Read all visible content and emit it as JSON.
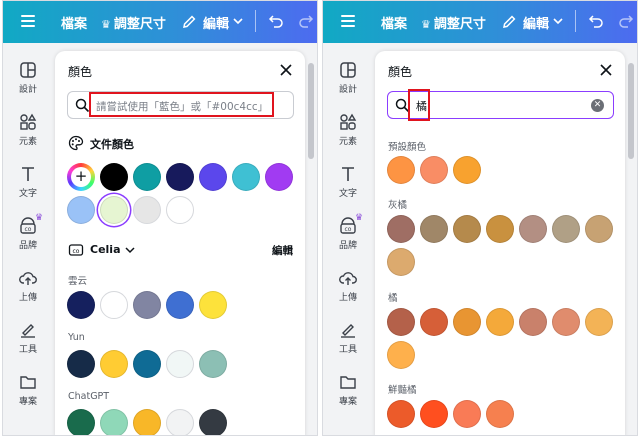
{
  "topbar": {
    "file": "檔案",
    "resize": "調整尺寸",
    "edit": "編輯"
  },
  "sidebar": {
    "items": [
      {
        "icon": "layout-icon",
        "label": "設計"
      },
      {
        "icon": "elements-icon",
        "label": "元素"
      },
      {
        "icon": "text-icon",
        "label": "文字"
      },
      {
        "icon": "brand-icon",
        "label": "品牌"
      },
      {
        "icon": "upload-icon",
        "label": "上傳"
      },
      {
        "icon": "draw-icon",
        "label": "工具"
      },
      {
        "icon": "projects-icon",
        "label": "專案"
      }
    ]
  },
  "left_drawer": {
    "title": "顏色",
    "search_placeholder": "請嘗試使用「藍色」或「#00c4cc」",
    "doc_colors_label": "文件顏色",
    "doc_colors": [
      "#000000",
      "#0f9ea3",
      "#171a5c",
      "#5b47ec",
      "#3fc0d3",
      "#a13bf2",
      "#9ac2f7",
      "#e6f5d2",
      "#e6e6e6",
      "#ffffff"
    ],
    "brand_kit_name": "Celia",
    "edit_label": "編輯",
    "palettes": [
      {
        "name": "雲云",
        "colors": [
          "#15205e",
          "#ffffff",
          "#8185a2",
          "#3f6fd2",
          "#fde23b"
        ]
      },
      {
        "name": "Yun",
        "colors": [
          "#162b48",
          "#ffcc33",
          "#0f6b95",
          "#f1f7f6",
          "#8cbfb4"
        ]
      },
      {
        "name": "ChatGPT",
        "colors": [
          "#196b4c",
          "#8fd8b8",
          "#f8b728",
          "#f2f3f4",
          "#343a42"
        ]
      }
    ]
  },
  "right_drawer": {
    "title": "顏色",
    "search_value": "橘",
    "groups": [
      {
        "name": "預設顏色",
        "colors": [
          "#fd9443",
          "#f98d65",
          "#f8a22f"
        ]
      },
      {
        "name": "灰橘",
        "colors": [
          "#9f6e64",
          "#a08768",
          "#b58a4c",
          "#c9913f",
          "#b38f83",
          "#b0a086",
          "#c7a273",
          "#dcaa6e"
        ]
      },
      {
        "name": "橘",
        "colors": [
          "#b4614a",
          "#d65f38",
          "#e89532",
          "#f4a93a",
          "#c9816b",
          "#e08c6d",
          "#f3b356",
          "#feb04c"
        ]
      },
      {
        "name": "鮮豔橘",
        "colors": [
          "#ec5b2a",
          "#ff4f1f",
          "#f97b56",
          "#f6804f"
        ]
      }
    ]
  }
}
